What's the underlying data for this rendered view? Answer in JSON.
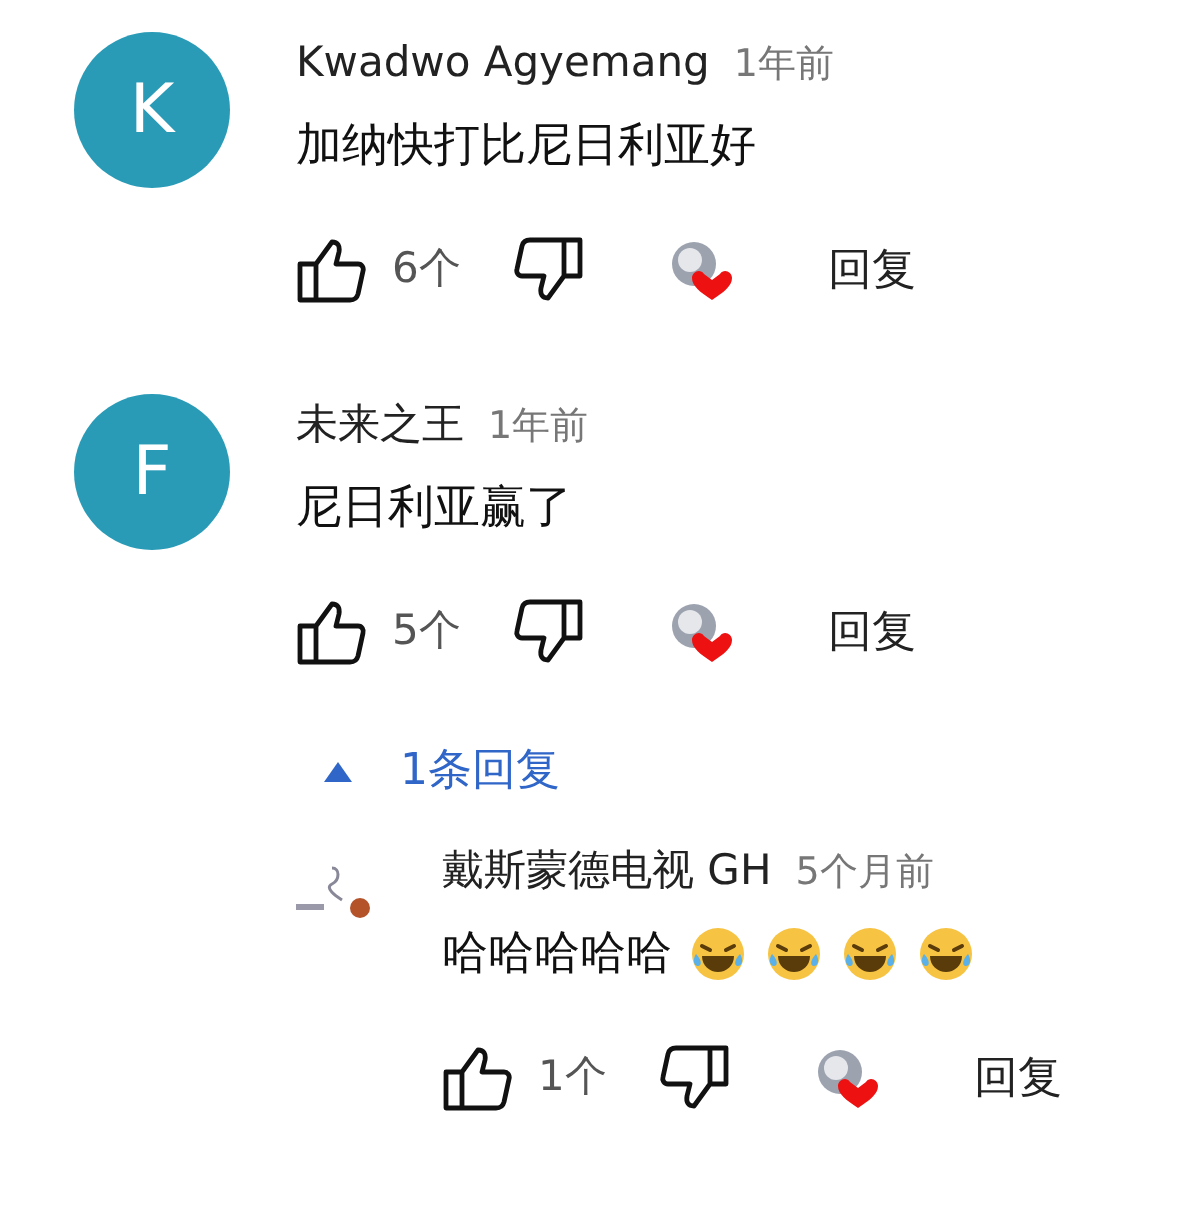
{
  "comments": [
    {
      "avatar": "K",
      "author": "Kwadwo Agyemang",
      "time": "1年前",
      "text": "加纳快打比尼日利亚好",
      "likes": "6个",
      "reply": "回复",
      "hearted": true
    },
    {
      "avatar": "F",
      "author": "未来之王",
      "time": "1年前",
      "text": "尼日利亚赢了",
      "likes": "5个",
      "reply": "回复",
      "hearted": true,
      "replies_toggle": {
        "label": "1条回复",
        "expanded": true
      },
      "replies": [
        {
          "author": "戴斯蒙德电视 GH",
          "time": "5个月前",
          "text": "哈哈哈哈哈",
          "emojis": [
            {
              "kind": "laughing"
            },
            {
              "kind": "laughing"
            },
            {
              "kind": "laughing"
            },
            {
              "kind": "laughing"
            }
          ],
          "likes": "1个",
          "reply": "回复",
          "hearted": true
        }
      ]
    }
  ]
}
